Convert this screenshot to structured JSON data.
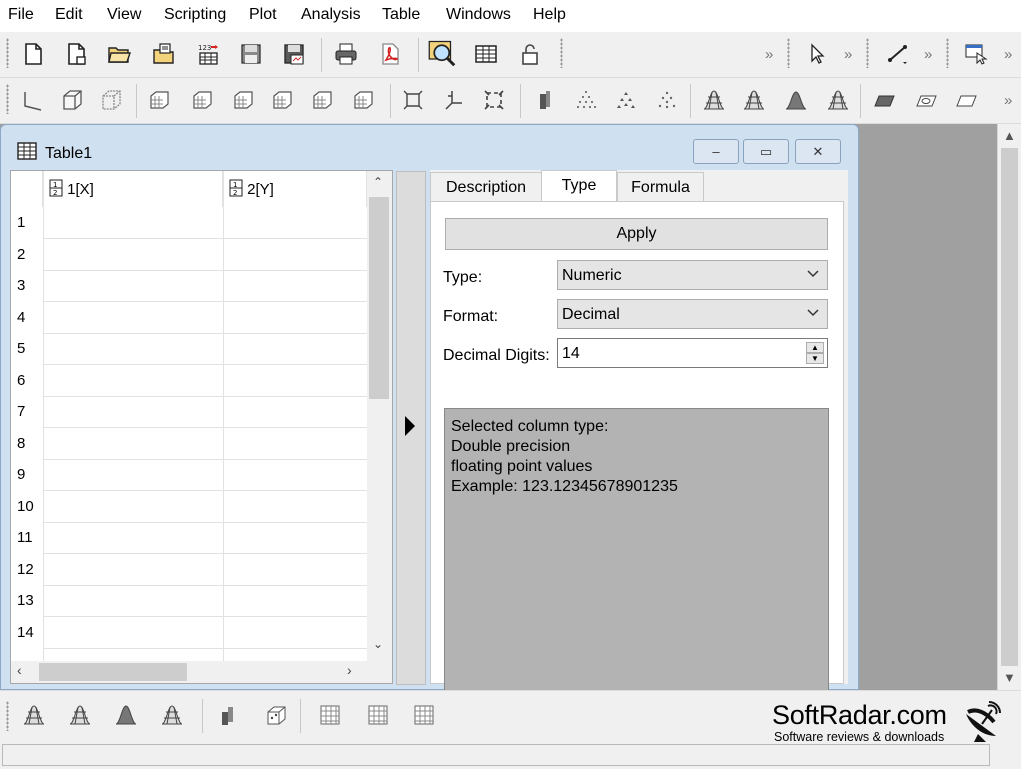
{
  "menu": [
    "File",
    "Edit",
    "View",
    "Scripting",
    "Plot",
    "Analysis",
    "Table",
    "Windows",
    "Help"
  ],
  "toolbar1": {
    "icons": [
      "new-project-icon",
      "new-document-icon",
      "open-folder-icon",
      "open-recent-icon",
      "import-ascii-icon",
      "save-icon",
      "save-as-template-icon",
      "print-icon",
      "export-pdf-icon",
      "find-icon",
      "table-icon",
      "lock-icon"
    ],
    "more": "»"
  },
  "toolbar2": {
    "icons": [
      "axis-icon",
      "cube-icon",
      "cube-outline-icon",
      "grid-box-icon",
      "grid-box-2-icon",
      "box-front-icon",
      "box-side-icon",
      "box-top-icon",
      "box-floor-icon",
      "frame-icon",
      "perspective-icon",
      "fit-icon",
      "bars3d-icon",
      "scatter3d-icon",
      "trajectory3d-icon",
      "dots3d-icon",
      "mesh-icon",
      "mesh2-icon",
      "surface-icon",
      "mesh3-icon",
      "plane-icon",
      "plane2-icon",
      "plane3-icon"
    ],
    "more": "»"
  },
  "table_window": {
    "title": "Table1",
    "buttons": {
      "minimize": "–",
      "restore": "▭",
      "close": "✕"
    },
    "columns": [
      {
        "label": "1[X]"
      },
      {
        "label": "2[Y]"
      }
    ],
    "rows": [
      "1",
      "2",
      "3",
      "4",
      "5",
      "6",
      "7",
      "8",
      "9",
      "10",
      "11",
      "12",
      "13",
      "14"
    ]
  },
  "panel": {
    "tabs": [
      "Description",
      "Type",
      "Formula"
    ],
    "active_tab": "Type",
    "apply_label": "Apply",
    "type_label": "Type:",
    "type_value": "Numeric",
    "format_label": "Format:",
    "format_value": "Decimal",
    "digits_label": "Decimal Digits:",
    "digits_value": "14",
    "description_lines": [
      "Selected column type:",
      "Double precision",
      "floating point values",
      "Example: 123.12345678901235"
    ]
  },
  "bottom_toolbar": {
    "icons": [
      "mesh-bottom-icon",
      "mesh-bottom-2-icon",
      "surface-bottom-icon",
      "mesh-bottom-3-icon",
      "bars-bottom-icon",
      "scatter-cube-icon",
      "grid-pattern-icon",
      "grid-pattern-2-icon",
      "grid-pattern-3-icon"
    ]
  },
  "watermark": {
    "name": "SoftRadar.com",
    "tagline": "Software reviews & downloads"
  }
}
